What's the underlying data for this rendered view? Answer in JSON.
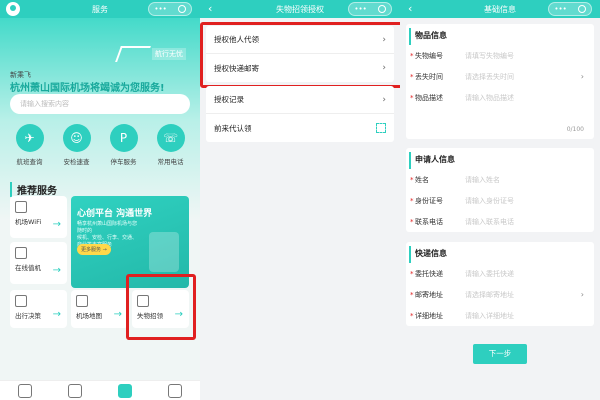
{
  "screen1": {
    "title": "服务",
    "capsule_dots": "•••",
    "logo_text": "航行无忧",
    "greeting": "新乘飞",
    "slogan": "杭州萧山国际机场将竭诚为您服务!",
    "search_placeholder": "请输入搜索内容",
    "quick_items": [
      {
        "label": "航班查询",
        "icon": "plane-icon"
      },
      {
        "label": "安检速查",
        "icon": "person-badge-icon"
      },
      {
        "label": "停车服务",
        "icon": "parking-icon"
      },
      {
        "label": "常用电话",
        "icon": "phone-icon"
      }
    ],
    "recommend_title": "推荐服务",
    "tiles": {
      "wifi": "机场WiFi",
      "check_in": "在线值机",
      "exit": "出行决策",
      "map": "机场地图",
      "lost": "失物招领"
    },
    "banner": {
      "title": "心创平台 沟通世界",
      "desc": "畅享杭州萧山国际机场与您随时的",
      "desc2": "候机、安检、行李、交通、商业等丰富服务",
      "button": "更多服务 →"
    }
  },
  "screen2": {
    "title": "失物招领授权",
    "capsule_dots": "•••",
    "menu_a": [
      "授权他人代领",
      "授权快递邮寄"
    ],
    "menu_b": [
      "授权记录",
      "前来代认领"
    ]
  },
  "screen3": {
    "title": "基础信息",
    "capsule_dots": "•••",
    "item_section": {
      "title": "物品信息",
      "rows": [
        {
          "label": "失物编号",
          "placeholder": "请填写失物编号",
          "required": "*"
        },
        {
          "label": "丢失时间",
          "placeholder": "请选择丢失时间",
          "required": "*"
        },
        {
          "label": "物品描述",
          "placeholder": "请输入物品描述",
          "required": "*"
        }
      ],
      "counter": "0/100"
    },
    "applicant_section": {
      "title": "申请人信息",
      "rows": [
        {
          "label": "姓名",
          "placeholder": "请输入姓名",
          "required": "*"
        },
        {
          "label": "身份证号",
          "placeholder": "请输入身份证号",
          "required": "*"
        },
        {
          "label": "联系电话",
          "placeholder": "请输入联系电话",
          "required": "*"
        }
      ]
    },
    "delivery_section": {
      "title": "快递信息",
      "rows": [
        {
          "label": "委托快递",
          "placeholder": "请输入委托快递",
          "required": "*"
        },
        {
          "label": "邮寄地址",
          "placeholder": "请选择邮寄地址",
          "required": "*"
        },
        {
          "label": "详细地址",
          "placeholder": "请输入详细地址",
          "required": "*"
        }
      ]
    },
    "next_button": "下一步"
  },
  "colors": {
    "accent": "#2ecfbf",
    "highlight": "#e02020"
  }
}
